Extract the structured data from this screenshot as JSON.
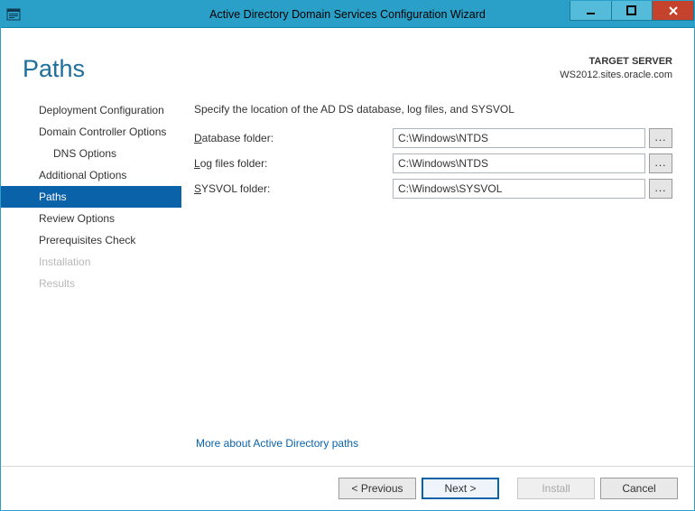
{
  "window": {
    "title": "Active Directory Domain Services Configuration Wizard"
  },
  "header": {
    "page_title": "Paths",
    "target_label": "TARGET SERVER",
    "target_value": "WS2012.sites.oracle.com"
  },
  "sidebar": {
    "items": [
      {
        "label": "Deployment Configuration",
        "state": "normal"
      },
      {
        "label": "Domain Controller Options",
        "state": "normal"
      },
      {
        "label": "DNS Options",
        "state": "normal",
        "indent": true
      },
      {
        "label": "Additional Options",
        "state": "normal"
      },
      {
        "label": "Paths",
        "state": "selected"
      },
      {
        "label": "Review Options",
        "state": "normal"
      },
      {
        "label": "Prerequisites Check",
        "state": "normal"
      },
      {
        "label": "Installation",
        "state": "disabled"
      },
      {
        "label": "Results",
        "state": "disabled"
      }
    ]
  },
  "main": {
    "instruction": "Specify the location of the AD DS database, log files, and SYSVOL",
    "rows": [
      {
        "label_pre": "D",
        "label_rest": "atabase folder:",
        "value": "C:\\Windows\\NTDS"
      },
      {
        "label_pre": "L",
        "label_rest": "og files folder:",
        "value": "C:\\Windows\\NTDS"
      },
      {
        "label_pre": "S",
        "label_rest": "YSVOL folder:",
        "value": "C:\\Windows\\SYSVOL"
      }
    ],
    "browse_label": "...",
    "more_link": "More about Active Directory paths"
  },
  "footer": {
    "previous": "< Previous",
    "next": "Next >",
    "install": "Install",
    "cancel": "Cancel"
  }
}
